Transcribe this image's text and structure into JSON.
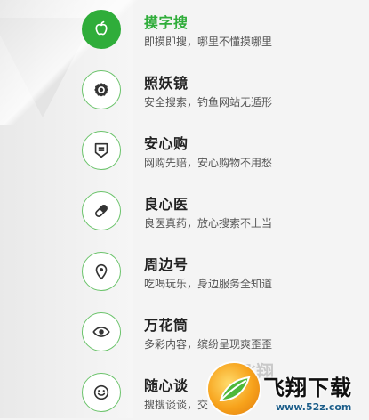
{
  "accent": "#2fad3a",
  "items": [
    {
      "title": "摸字搜",
      "desc": "即摸即搜，哪里不懂摸哪里",
      "icon": "apple-icon",
      "active": true
    },
    {
      "title": "照妖镜",
      "desc": "安全搜索，钓鱼网站无遁形",
      "icon": "gear-icon",
      "active": false
    },
    {
      "title": "安心购",
      "desc": "网购先赔，安心购物不用愁",
      "icon": "shield-icon",
      "active": false
    },
    {
      "title": "良心医",
      "desc": "良医真药，放心搜索不上当",
      "icon": "pill-icon",
      "active": false
    },
    {
      "title": "周边号",
      "desc": "吃喝玩乐，身边服务全知道",
      "icon": "location-pin-icon",
      "active": false
    },
    {
      "title": "万花筒",
      "desc": "多彩内容，缤纷呈现爽歪歪",
      "icon": "eye-icon",
      "active": false
    },
    {
      "title": "随心谈",
      "desc": "搜搜谈谈，交",
      "icon": "smiley-icon",
      "active": false
    }
  ],
  "watermark": {
    "title": "飞翔下载",
    "url": "www.52z.com",
    "ghost": "飞翔"
  }
}
